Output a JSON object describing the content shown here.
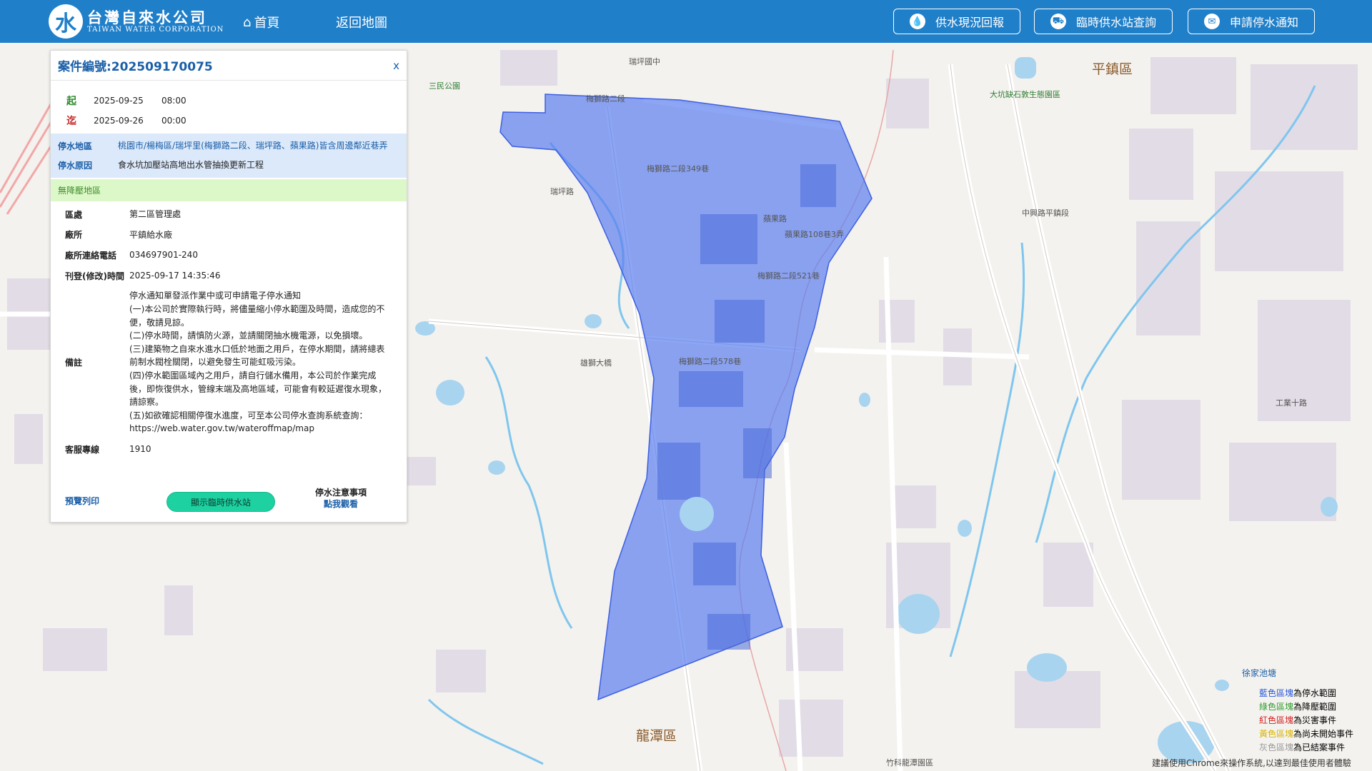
{
  "header": {
    "logo_cn": "台灣自來水公司",
    "logo_en": "TAIWAN WATER CORPORATION",
    "logo_mark": "水",
    "nav_home": "首頁",
    "nav_back": "返回地圖",
    "btn_report": "供水現況回報",
    "btn_station": "臨時供水站查詢",
    "btn_apply": "申請停水通知"
  },
  "panel": {
    "title": "案件編號:202509170075",
    "close": "x",
    "start_key": "起",
    "start_date": "2025-09-25",
    "start_time": "08:00",
    "end_key": "迄",
    "end_date": "2025-09-26",
    "end_time": "00:00",
    "area_key": "停水地區",
    "area_val": "桃園市/楊梅區/瑞坪里(梅獅路二段、瑞坪路、蘋果路)皆含周邊鄰近巷弄",
    "reason_key": "停水原因",
    "reason_val": "食水坑加壓站高地出水管抽換更新工程",
    "pressure": "無降壓地區",
    "rows": [
      {
        "k": "區處",
        "v": "第二區管理處"
      },
      {
        "k": "廠所",
        "v": "平鎮給水廠"
      },
      {
        "k": "廠所連絡電話",
        "v": "034697901-240"
      },
      {
        "k": "刊登(修改)時間",
        "v": "2025-09-17 14:35:46"
      }
    ],
    "remark_key": "備註",
    "remark_val": "停水通知單發派作業中或可申請電子停水通知\n(一)本公司於實際執行時，將儘量縮小停水範圍及時間，造成您的不便，敬請見諒。\n(二)停水時間，請慎防火源，並請關閉抽水機電源，以免損壞。\n(三)建築物之自來水進水口低於地面之用戶，在停水期間，請將總表前制水閥栓關閉，以避免發生可能虹吸污染。\n(四)停水範圍區域內之用戶，請自行儲水備用，本公司於作業完成後，即恢復供水，管線末端及高地區域，可能會有較延遲復水現象，請諒察。\n(五)如欲確認相關停復水進度，可至本公司停水查詢系統查詢：https://web.water.gov.tw/wateroffmap/map",
    "hotline_key": "客服專線",
    "hotline_val": "1910",
    "preview": "預覽列印",
    "show_station": "顯示臨時供水站",
    "notice_title": "停水注意事項",
    "notice_link": "點我觀看"
  },
  "map": {
    "districts": [
      "平鎮區",
      "龍潭區"
    ],
    "labels": [
      "梅獅路二段",
      "梅獅路二段349巷",
      "蘋果路",
      "蘋果路108巷3弄",
      "梅獅路二段521巷",
      "梅獅路二段578巷",
      "瑞坪路",
      "雄獅大橋",
      "徐家池塘",
      "中興路平鎮段",
      "工業十路",
      "瑞坪國中",
      "三民公園",
      "大坑缺石敦生態園區",
      "竹科龍潭園區"
    ],
    "polygon_color": "#5b7ff0"
  },
  "legend": [
    {
      "c": "藍色區塊",
      "t": "為停水範圍",
      "color": "#2255dd"
    },
    {
      "c": "綠色區塊",
      "t": "為降壓範圍",
      "color": "#2e9b2e"
    },
    {
      "c": "紅色區塊",
      "t": "為災害事件",
      "color": "#d02020"
    },
    {
      "c": "黃色區塊",
      "t": "為尚未開始事件",
      "color": "#d7b400"
    },
    {
      "c": "灰色區塊",
      "t": "為已結案事件",
      "color": "#999999"
    }
  ],
  "footnote": "建議使用Chrome來操作系統,以達到最佳使用者體驗"
}
